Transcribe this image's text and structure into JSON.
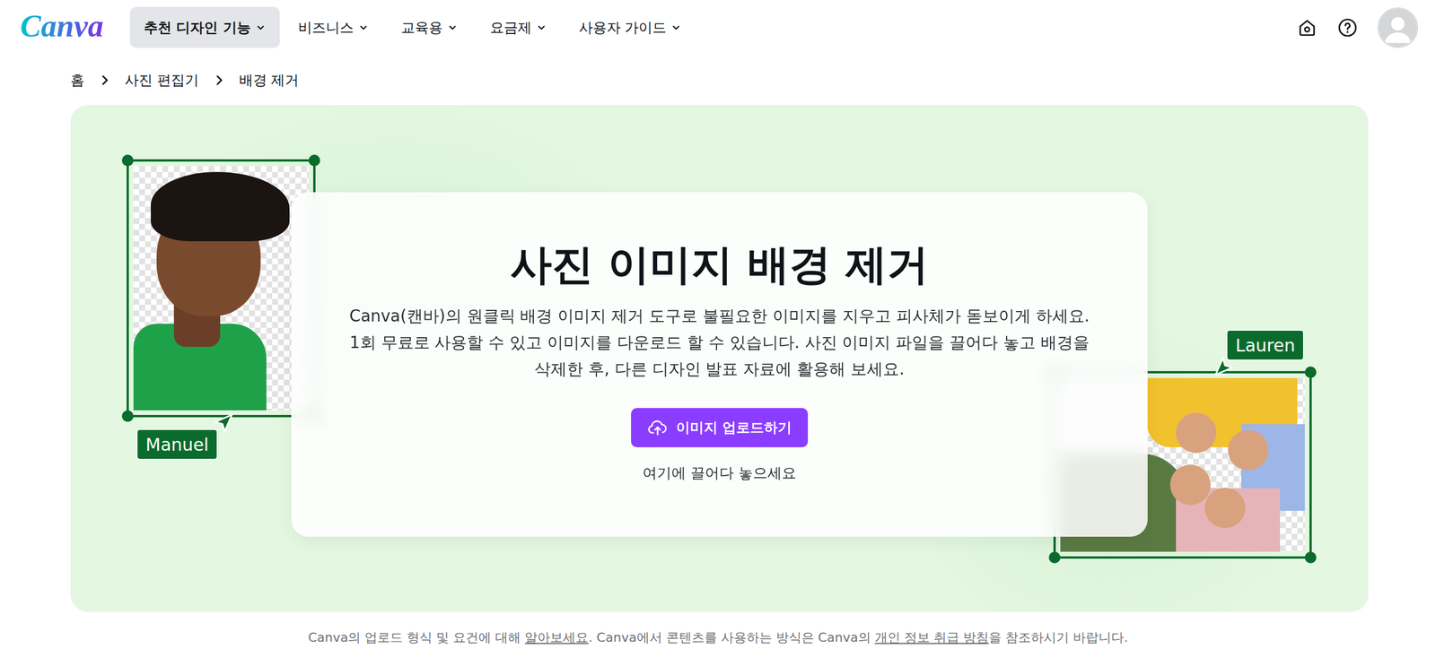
{
  "logo": "Canva",
  "nav": [
    {
      "label": "추천 디자인 기능",
      "selected": true
    },
    {
      "label": "비즈니스",
      "selected": false
    },
    {
      "label": "교육용",
      "selected": false
    },
    {
      "label": "요금제",
      "selected": false
    },
    {
      "label": "사용자 가이드",
      "selected": false
    }
  ],
  "breadcrumb": [
    "홈",
    "사진 편집기",
    "배경 제거"
  ],
  "hero": {
    "title": "사진 이미지 배경 제거",
    "description": [
      "Canva(캔바)의 원클릭 배경 이미지 제거 도구로 불필요한 이미지를 지우고 피사체가 돋보이게 하세요.",
      "1회 무료로 사용할 수 있고 이미지를 다운로드 할 수 있습니다. 사진 이미지 파일을 끌어다 놓고 배경을",
      "삭제한 후, 다른 디자인 발표 자료에 활용해 보세요."
    ],
    "upload_button": "이미지 업로드하기",
    "drop_hint": "여기에 끌어다 놓으세요"
  },
  "collaborators": [
    {
      "name": "Manuel"
    },
    {
      "name": "Lauren"
    }
  ],
  "footer": [
    {
      "text": "Canva의 업로드 형식 및 요건에 대해 ",
      "link": false
    },
    {
      "text": "알아보세요",
      "link": true
    },
    {
      "text": ". Canva에서 콘텐츠를 사용하는 방식은 Canva의 ",
      "link": false
    },
    {
      "text": "개인 정보 취급 방침",
      "link": true
    },
    {
      "text": "을 참조하시기 바랍니다.",
      "link": false
    }
  ]
}
